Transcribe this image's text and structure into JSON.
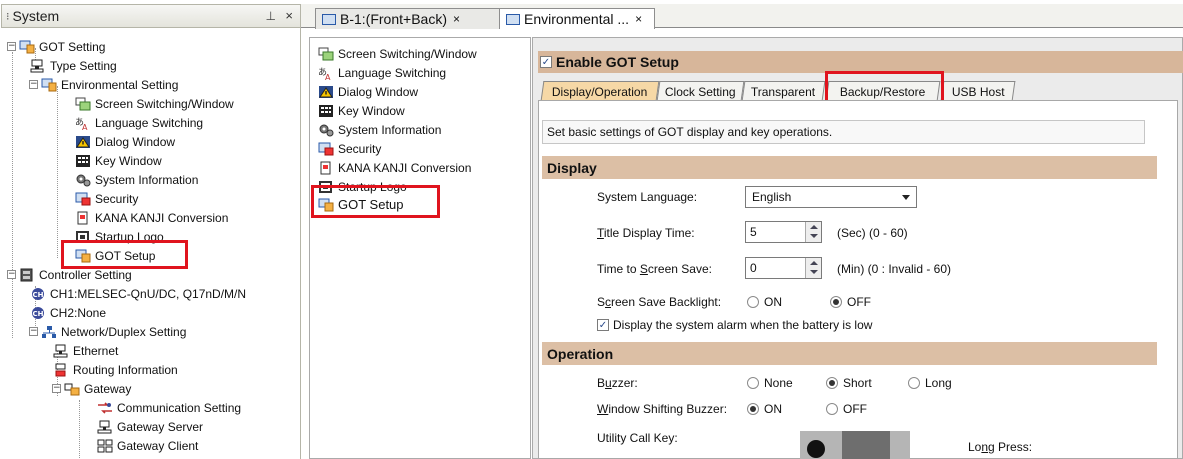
{
  "system_panel": {
    "title": "System",
    "pin_glyph": "⊥",
    "close_glyph": "×"
  },
  "tree": {
    "got_setting": "GOT Setting",
    "type_setting": "Type Setting",
    "environmental_setting": "Environmental Setting",
    "screen_switching": "Screen Switching/Window",
    "language_switching": "Language Switching",
    "dialog_window": "Dialog Window",
    "key_window": "Key Window",
    "system_information": "System Information",
    "security": "Security",
    "kana_kanji": "KANA KANJI Conversion",
    "startup_logo": "Startup Logo",
    "got_setup": "GOT Setup",
    "controller_setting": "Controller Setting",
    "ch1": "CH1:MELSEC-QnU/DC, Q17nD/M/N",
    "ch2": "CH2:None",
    "network_duplex": "Network/Duplex Setting",
    "ethernet": "Ethernet",
    "routing_information": "Routing Information",
    "gateway": "Gateway",
    "communication_setting": "Communication Setting",
    "gateway_server": "Gateway Server",
    "gateway_client": "Gateway Client"
  },
  "doc_tabs": [
    {
      "label": "B-1:(Front+Back)",
      "close": "×"
    },
    {
      "label": "Environmental ...",
      "close": "×"
    }
  ],
  "nav_list": [
    "Screen Switching/Window",
    "Language Switching",
    "Dialog Window",
    "Key Window",
    "System Information",
    "Security",
    "KANA KANJI Conversion",
    "Startup Logo",
    "GOT Setup"
  ],
  "setup": {
    "enable_label": "Enable GOT Setup",
    "enable_checked": true,
    "tabs": [
      "Display/Operation",
      "Clock Setting",
      "Transparent",
      "Backup/Restore",
      "USB Host"
    ],
    "active_tab": "Display/Operation",
    "description": "Set basic settings of GOT display and key operations.",
    "display": {
      "header": "Display",
      "language_label": "System Language:",
      "language_value": "English",
      "title_time_label": "Title Display Time:",
      "title_time_value": "5",
      "title_time_range": "(Sec) (0 - 60)",
      "screen_save_label": "Time to Screen Save:",
      "screen_save_value": "0",
      "screen_save_range": "(Min) (0 : Invalid - 60)",
      "backlight_label": "Screen Save Backlight:",
      "backlight_on": "ON",
      "backlight_off": "OFF",
      "backlight_selected": "OFF",
      "battery_alarm_label": "Display the system alarm when the battery is low",
      "battery_alarm_checked": true
    },
    "operation": {
      "header": "Operation",
      "buzzer_label": "Buzzer:",
      "buzzer_none": "None",
      "buzzer_short": "Short",
      "buzzer_long": "Long",
      "buzzer_selected": "Short",
      "window_buzzer_label": "Window Shifting Buzzer:",
      "window_buzzer_on": "ON",
      "window_buzzer_off": "OFF",
      "window_buzzer_selected": "ON",
      "utility_key_label": "Utility Call Key:",
      "long_press_label": "Long Press:"
    }
  },
  "colors": {
    "highlight_box": "#e0141e",
    "section_header": "#dcbfa5",
    "enable_bar": "#d7b69a",
    "active_tab": "#f6d8a6"
  }
}
